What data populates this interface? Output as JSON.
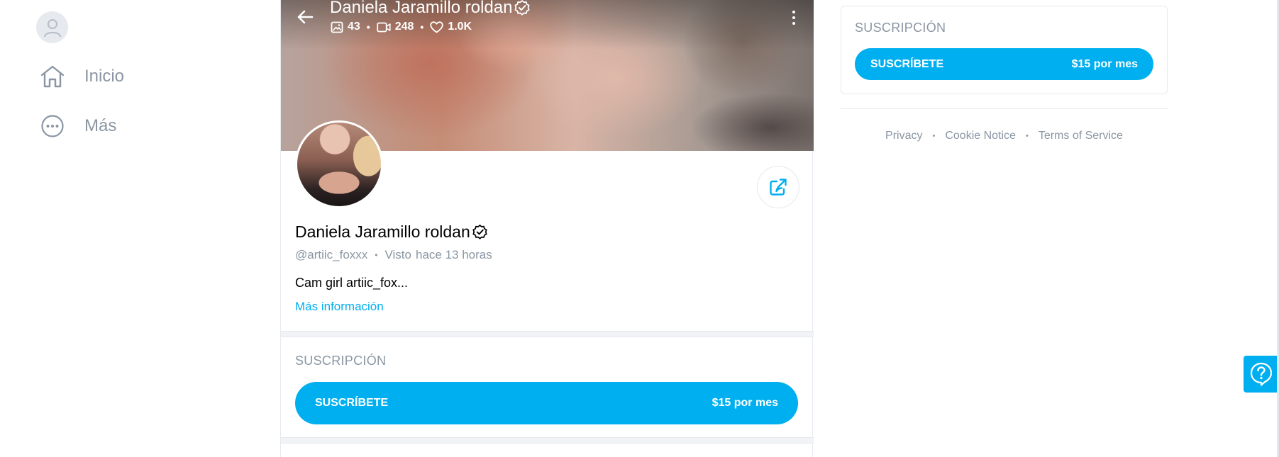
{
  "nav": {
    "items": [
      {
        "label": "Inicio",
        "icon": "home-icon"
      },
      {
        "label": "Más",
        "icon": "more-circle-icon"
      }
    ]
  },
  "profile": {
    "name": "Daniela Jaramillo roldan",
    "handle": "@artiic_foxxx",
    "seen_label": "Visto",
    "seen_time": "hace 13 horas",
    "bio": "Cam girl artiic_fox...",
    "more_info": "Más información",
    "stats": {
      "photos": "43",
      "videos": "248",
      "likes": "1.0K"
    }
  },
  "subscription": {
    "heading": "SUSCRIPCIÓN",
    "button_label": "SUSCRÍBETE",
    "price": "$15 por mes"
  },
  "footer": {
    "privacy": "Privacy",
    "cookie": "Cookie Notice",
    "terms": "Terms of Service"
  },
  "colors": {
    "accent": "#00aff0",
    "muted": "#8a96a3",
    "border": "#e6e9ee"
  }
}
